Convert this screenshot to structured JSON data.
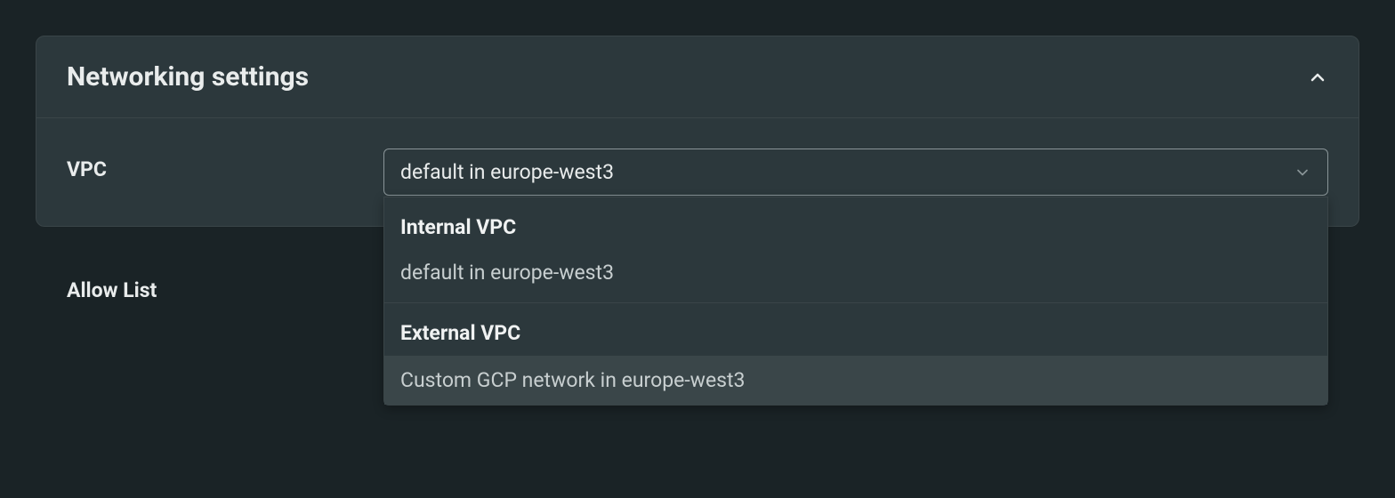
{
  "panel": {
    "title": "Networking settings"
  },
  "form": {
    "vpc_label": "VPC",
    "vpc_selected": "default in europe-west3",
    "allow_list_label": "Allow List"
  },
  "dropdown": {
    "groups": [
      {
        "label": "Internal VPC",
        "options": [
          {
            "text": "default in europe-west3",
            "highlighted": false
          }
        ]
      },
      {
        "label": "External VPC",
        "options": [
          {
            "text": "Custom GCP network in europe-west3",
            "highlighted": true
          }
        ]
      }
    ]
  }
}
